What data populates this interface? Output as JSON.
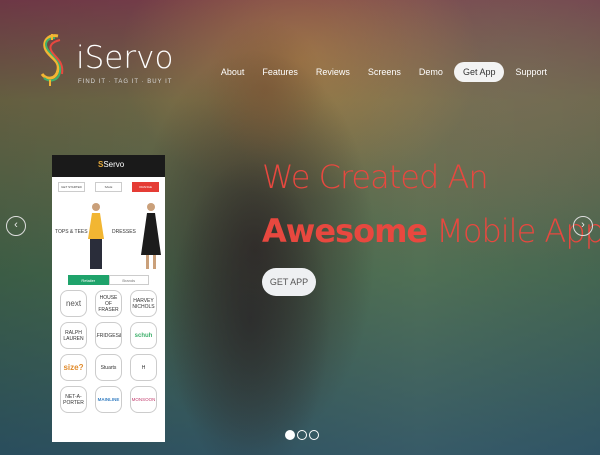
{
  "brand": {
    "name": "iServo",
    "tagline": "FIND IT · TAG IT · BUY IT",
    "colors": {
      "accent": "#e8483f",
      "button_bg": "#eef0f2",
      "phone_tab_active": "#1fa36b"
    }
  },
  "nav": {
    "items": [
      "About",
      "Features",
      "Reviews",
      "Screens",
      "Demo",
      "Get App",
      "Support"
    ],
    "active_index": 5
  },
  "hero": {
    "line1": "We Created An",
    "line2_bold": "Awesome",
    "line2_rest": " Mobile App",
    "cta": "GET APP",
    "prev_icon": "chevron-left-icon",
    "next_icon": "chevron-right-icon",
    "slides": 3,
    "active_slide": 0
  },
  "phone": {
    "logo_s": "S",
    "logo_text": "Servo",
    "buttons": [
      "GET STARTED",
      "SALE",
      "ORANGE"
    ],
    "categories": [
      "TOPS & TEES",
      "DRESSES"
    ],
    "tabs": [
      "Retailer",
      "Brands"
    ],
    "brands": [
      [
        "next",
        "HOUSE OF FRASER",
        "HARVEY NICHOLS"
      ],
      [
        "RALPH LAUREN",
        "SELFRIDGES&CO",
        "schuh"
      ],
      [
        "size?",
        "Stuarts",
        "H"
      ],
      [
        "NET-A-PORTER",
        "MAINLINE",
        "MONSOON"
      ]
    ]
  }
}
